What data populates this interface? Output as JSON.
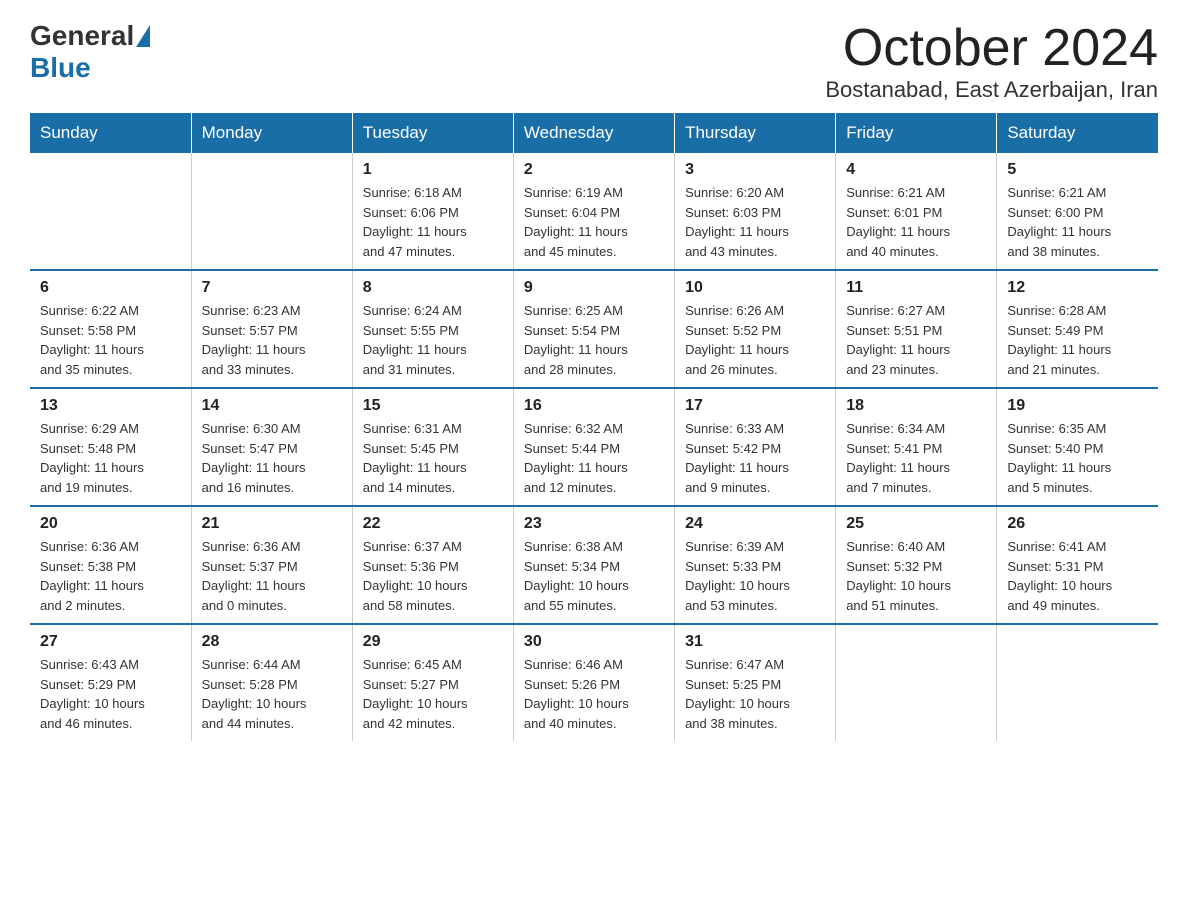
{
  "header": {
    "logo_general": "General",
    "logo_blue": "Blue",
    "month_title": "October 2024",
    "location": "Bostanabad, East Azerbaijan, Iran"
  },
  "weekdays": [
    "Sunday",
    "Monday",
    "Tuesday",
    "Wednesday",
    "Thursday",
    "Friday",
    "Saturday"
  ],
  "weeks": [
    [
      {
        "day": "",
        "info": ""
      },
      {
        "day": "",
        "info": ""
      },
      {
        "day": "1",
        "info": "Sunrise: 6:18 AM\nSunset: 6:06 PM\nDaylight: 11 hours\nand 47 minutes."
      },
      {
        "day": "2",
        "info": "Sunrise: 6:19 AM\nSunset: 6:04 PM\nDaylight: 11 hours\nand 45 minutes."
      },
      {
        "day": "3",
        "info": "Sunrise: 6:20 AM\nSunset: 6:03 PM\nDaylight: 11 hours\nand 43 minutes."
      },
      {
        "day": "4",
        "info": "Sunrise: 6:21 AM\nSunset: 6:01 PM\nDaylight: 11 hours\nand 40 minutes."
      },
      {
        "day": "5",
        "info": "Sunrise: 6:21 AM\nSunset: 6:00 PM\nDaylight: 11 hours\nand 38 minutes."
      }
    ],
    [
      {
        "day": "6",
        "info": "Sunrise: 6:22 AM\nSunset: 5:58 PM\nDaylight: 11 hours\nand 35 minutes."
      },
      {
        "day": "7",
        "info": "Sunrise: 6:23 AM\nSunset: 5:57 PM\nDaylight: 11 hours\nand 33 minutes."
      },
      {
        "day": "8",
        "info": "Sunrise: 6:24 AM\nSunset: 5:55 PM\nDaylight: 11 hours\nand 31 minutes."
      },
      {
        "day": "9",
        "info": "Sunrise: 6:25 AM\nSunset: 5:54 PM\nDaylight: 11 hours\nand 28 minutes."
      },
      {
        "day": "10",
        "info": "Sunrise: 6:26 AM\nSunset: 5:52 PM\nDaylight: 11 hours\nand 26 minutes."
      },
      {
        "day": "11",
        "info": "Sunrise: 6:27 AM\nSunset: 5:51 PM\nDaylight: 11 hours\nand 23 minutes."
      },
      {
        "day": "12",
        "info": "Sunrise: 6:28 AM\nSunset: 5:49 PM\nDaylight: 11 hours\nand 21 minutes."
      }
    ],
    [
      {
        "day": "13",
        "info": "Sunrise: 6:29 AM\nSunset: 5:48 PM\nDaylight: 11 hours\nand 19 minutes."
      },
      {
        "day": "14",
        "info": "Sunrise: 6:30 AM\nSunset: 5:47 PM\nDaylight: 11 hours\nand 16 minutes."
      },
      {
        "day": "15",
        "info": "Sunrise: 6:31 AM\nSunset: 5:45 PM\nDaylight: 11 hours\nand 14 minutes."
      },
      {
        "day": "16",
        "info": "Sunrise: 6:32 AM\nSunset: 5:44 PM\nDaylight: 11 hours\nand 12 minutes."
      },
      {
        "day": "17",
        "info": "Sunrise: 6:33 AM\nSunset: 5:42 PM\nDaylight: 11 hours\nand 9 minutes."
      },
      {
        "day": "18",
        "info": "Sunrise: 6:34 AM\nSunset: 5:41 PM\nDaylight: 11 hours\nand 7 minutes."
      },
      {
        "day": "19",
        "info": "Sunrise: 6:35 AM\nSunset: 5:40 PM\nDaylight: 11 hours\nand 5 minutes."
      }
    ],
    [
      {
        "day": "20",
        "info": "Sunrise: 6:36 AM\nSunset: 5:38 PM\nDaylight: 11 hours\nand 2 minutes."
      },
      {
        "day": "21",
        "info": "Sunrise: 6:36 AM\nSunset: 5:37 PM\nDaylight: 11 hours\nand 0 minutes."
      },
      {
        "day": "22",
        "info": "Sunrise: 6:37 AM\nSunset: 5:36 PM\nDaylight: 10 hours\nand 58 minutes."
      },
      {
        "day": "23",
        "info": "Sunrise: 6:38 AM\nSunset: 5:34 PM\nDaylight: 10 hours\nand 55 minutes."
      },
      {
        "day": "24",
        "info": "Sunrise: 6:39 AM\nSunset: 5:33 PM\nDaylight: 10 hours\nand 53 minutes."
      },
      {
        "day": "25",
        "info": "Sunrise: 6:40 AM\nSunset: 5:32 PM\nDaylight: 10 hours\nand 51 minutes."
      },
      {
        "day": "26",
        "info": "Sunrise: 6:41 AM\nSunset: 5:31 PM\nDaylight: 10 hours\nand 49 minutes."
      }
    ],
    [
      {
        "day": "27",
        "info": "Sunrise: 6:43 AM\nSunset: 5:29 PM\nDaylight: 10 hours\nand 46 minutes."
      },
      {
        "day": "28",
        "info": "Sunrise: 6:44 AM\nSunset: 5:28 PM\nDaylight: 10 hours\nand 44 minutes."
      },
      {
        "day": "29",
        "info": "Sunrise: 6:45 AM\nSunset: 5:27 PM\nDaylight: 10 hours\nand 42 minutes."
      },
      {
        "day": "30",
        "info": "Sunrise: 6:46 AM\nSunset: 5:26 PM\nDaylight: 10 hours\nand 40 minutes."
      },
      {
        "day": "31",
        "info": "Sunrise: 6:47 AM\nSunset: 5:25 PM\nDaylight: 10 hours\nand 38 minutes."
      },
      {
        "day": "",
        "info": ""
      },
      {
        "day": "",
        "info": ""
      }
    ]
  ]
}
